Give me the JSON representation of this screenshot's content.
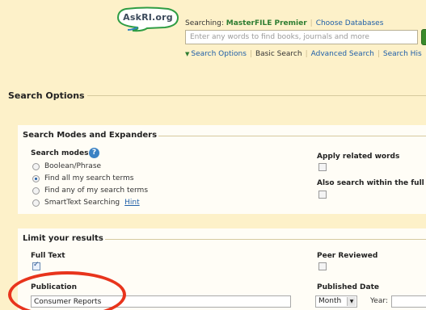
{
  "header": {
    "logo_text": "AskRI.org",
    "searching_label": "Searching:",
    "database": "MasterFILE Premier",
    "choose_databases": "Choose Databases",
    "search_placeholder": "Enter any words to find books, journals and more",
    "nav": {
      "search_options": "Search Options",
      "basic_search": "Basic Search",
      "advanced_search": "Advanced Search",
      "search_history": "Search His"
    }
  },
  "search_options": {
    "title": "Search Options",
    "modes_expanders": {
      "title": "Search Modes and Expanders",
      "search_modes_label": "Search modes",
      "modes": [
        {
          "label": "Boolean/Phrase",
          "selected": false
        },
        {
          "label": "Find all my search terms",
          "selected": true
        },
        {
          "label": "Find any of my search terms",
          "selected": false
        },
        {
          "label": "SmartText Searching",
          "selected": false
        }
      ],
      "hint": "Hint",
      "apply_related_words": "Apply related words",
      "also_search_within": "Also search within the full t"
    },
    "limit_results": {
      "title": "Limit your results",
      "full_text": "Full Text",
      "peer_reviewed": "Peer Reviewed",
      "publication": "Publication",
      "publication_value": "Consumer Reports",
      "published_date": "Published Date",
      "month": "Month",
      "year_label": "Year:"
    }
  },
  "colors": {
    "background": "#fdf1c9",
    "link": "#1f5fa8",
    "database_green": "#2e7d32",
    "annotation_red": "#e8341c"
  }
}
